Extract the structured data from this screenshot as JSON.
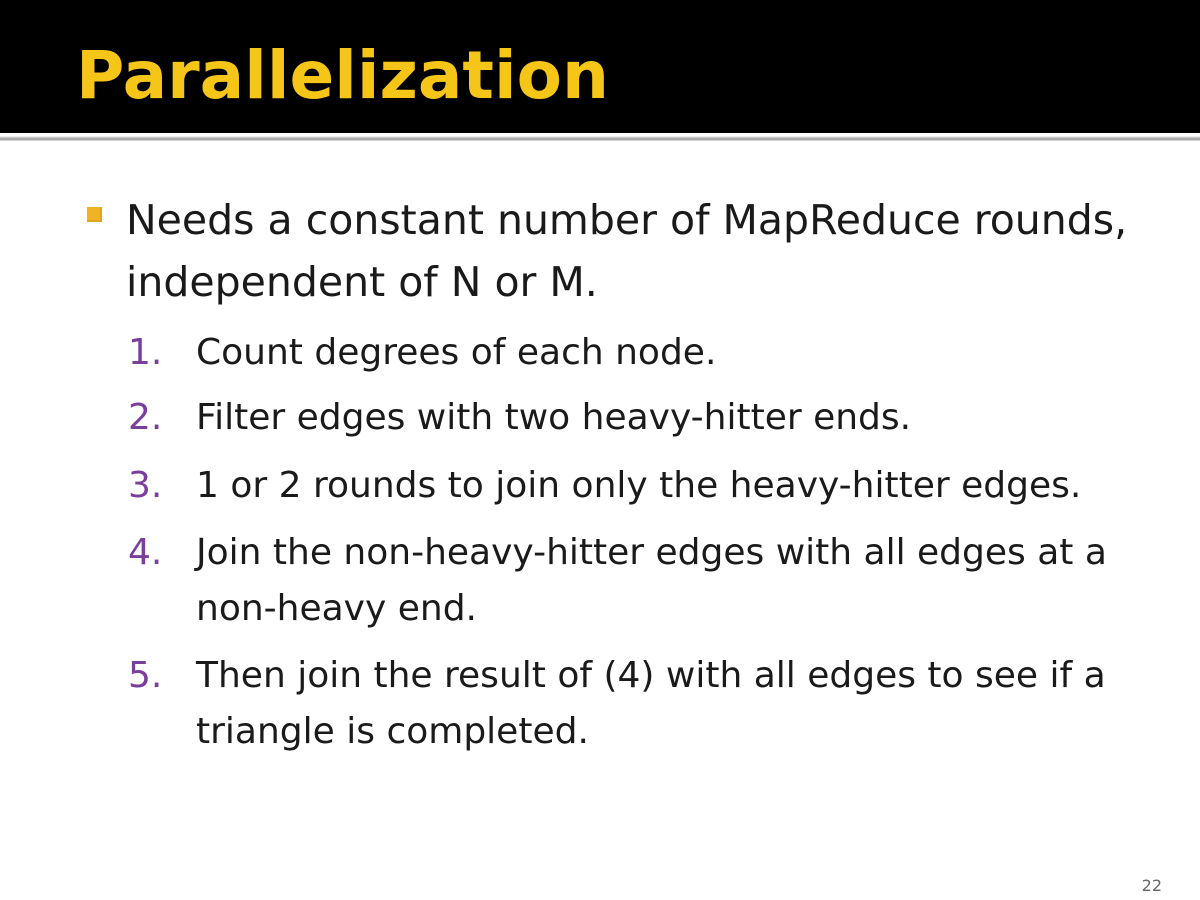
{
  "slide": {
    "title": "Parallelization",
    "page_number": "22"
  },
  "bullet": {
    "text": "Needs a constant number of MapReduce rounds, independent of N or M."
  },
  "steps": [
    {
      "number": "1.",
      "text": "Count degrees of each node."
    },
    {
      "number": "2.",
      "text": "Filter edges with two heavy-hitter ends."
    },
    {
      "number": "3.",
      "text": "1 or 2 rounds to join only the heavy-hitter edges."
    },
    {
      "number": "4.",
      "text": "Join the non-heavy-hitter edges with all edges at a non-heavy end."
    },
    {
      "number": "5.",
      "text": "Then join the result of (4) with all edges to see if a triangle is completed."
    }
  ],
  "colors": {
    "title_bar": "#000000",
    "title_text": "#f5c518",
    "bullet_marker": "#f0b323",
    "step_numbers": "#7a3f9d",
    "body_text": "#1a1a1a"
  }
}
